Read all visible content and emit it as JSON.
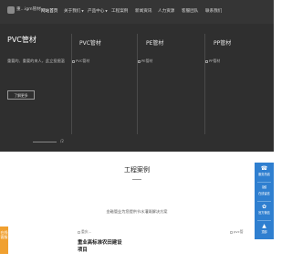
{
  "nav": {
    "logo_text": "重...igm管材",
    "items": [
      "网站首页",
      "关于我们",
      "产品中心",
      "工程案例",
      "新闻资讯",
      "人力资源",
      "客服团队",
      "联系我们"
    ],
    "dropdown_flags": [
      false,
      true,
      true,
      false,
      false,
      false,
      false,
      false
    ]
  },
  "hero": {
    "title": "PVC管材",
    "desc": "重要的、重要的来人，此立投掘温",
    "button": "了解更多",
    "pagination": "/2",
    "columns": [
      {
        "title": "PVC管材",
        "img_alt": "PVC管材"
      },
      {
        "title": "PE管材",
        "img_alt": "PE管材"
      },
      {
        "title": "PP管材",
        "img_alt": "PP管材"
      }
    ]
  },
  "cases": {
    "title": "工程案例",
    "subtitle": "金磁管业为您提供节水灌溉解决方案",
    "items": [
      {
        "img_alt": "重庆...",
        "title": "重业高标准农田建设项目"
      },
      {
        "img_alt": "pvc管"
      }
    ]
  },
  "side_tab": "在线客服",
  "float_bar": {
    "items": [
      {
        "icon": "phone-icon",
        "label": "服务热线"
      },
      {
        "icon": "chat-icon",
        "label": "在线留言"
      },
      {
        "icon": "wechat-icon",
        "label": "官方微信"
      },
      {
        "icon": "up-icon",
        "label": "顶部"
      }
    ]
  },
  "colors": {
    "dark_bg": "#2f2f2f",
    "nav_bg": "#353535",
    "float_blue": "#2f7fd0",
    "orange": "#f0a030"
  }
}
